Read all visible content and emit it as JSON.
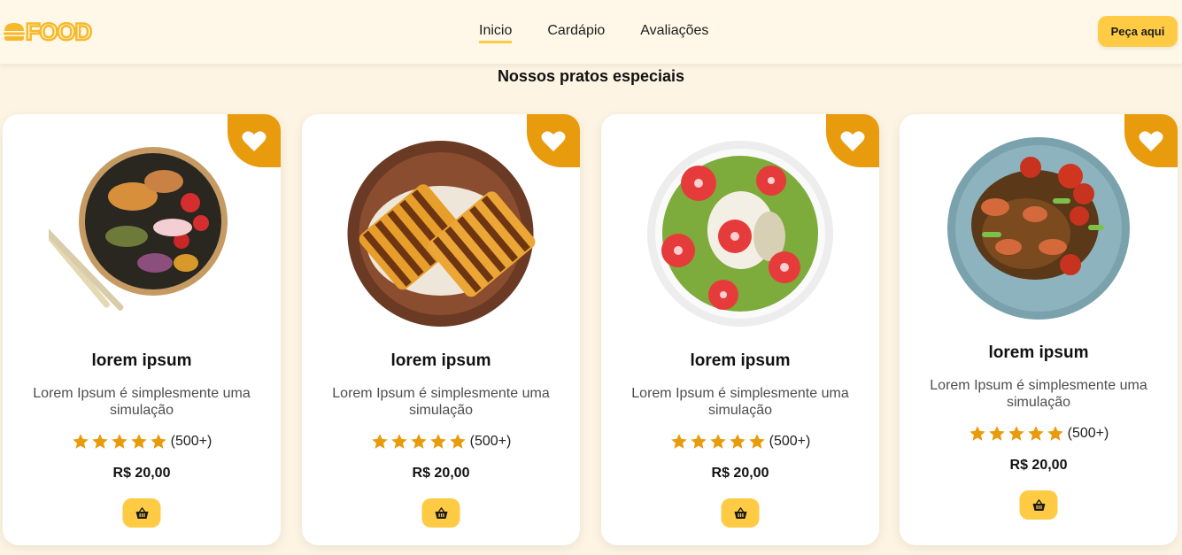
{
  "header": {
    "logo": "FOOD",
    "nav": [
      {
        "label": "Inicio",
        "active": true
      },
      {
        "label": "Cardápio",
        "active": false
      },
      {
        "label": "Avaliações",
        "active": false
      }
    ],
    "order_button": "Peça aqui"
  },
  "section": {
    "title": "Nossos pratos especiais"
  },
  "cards": [
    {
      "dish": "noodle-bowl-with-chopsticks",
      "title": "lorem ipsum",
      "description": "Lorem Ipsum é simplesmente uma simulação",
      "rating": 5,
      "rating_count": "(500+)",
      "price": "R$ 20,00"
    },
    {
      "dish": "grilled-sandwich-plate",
      "title": "lorem ipsum",
      "description": "Lorem Ipsum é simplesmente uma simulação",
      "rating": 5,
      "rating_count": "(500+)",
      "price": "R$ 20,00"
    },
    {
      "dish": "kiwi-strawberry-bowl",
      "title": "lorem ipsum",
      "description": "Lorem Ipsum é simplesmente uma simulação",
      "rating": 5,
      "rating_count": "(500+)",
      "price": "R$ 20,00"
    },
    {
      "dish": "shrimp-noodles-plate",
      "title": "lorem ipsum",
      "description": "Lorem Ipsum é simplesmente uma simulação",
      "rating": 5,
      "rating_count": "(500+)",
      "price": "R$ 20,00"
    }
  ],
  "icons": {
    "logo": "burger-icon",
    "favorite": "heart-icon",
    "star": "star-icon",
    "cart": "basket-icon"
  },
  "colors": {
    "accent": "#ffcb45",
    "favorite_bg": "#e89b0c",
    "star": "#e89b0c",
    "background": "#fdf4e3"
  }
}
